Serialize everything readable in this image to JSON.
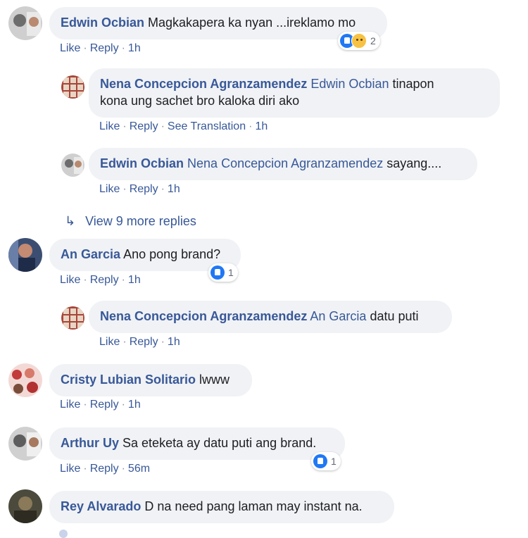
{
  "comments": [
    {
      "name": "Edwin Ocbian",
      "text": "Magkakapera ka nyan ...ireklamo mo",
      "actions": {
        "like": "Like",
        "reply": "Reply",
        "time": "1h"
      },
      "reactions": {
        "count": "2",
        "icons": [
          "like-icon",
          "sad-icon"
        ]
      },
      "replies": [
        {
          "name": "Nena Concepcion Agranzamendez",
          "tag": "Edwin Ocbian",
          "text_line1": "tinapon",
          "text_line2": "kona ung sachet bro kaloka diri ako",
          "actions": {
            "like": "Like",
            "reply": "Reply",
            "translate": "See Translation",
            "time": "1h"
          }
        },
        {
          "name": "Edwin Ocbian",
          "tag": "Nena Concepcion Agranzamendez",
          "text": "sayang....",
          "actions": {
            "like": "Like",
            "reply": "Reply",
            "time": "1h"
          }
        }
      ],
      "view_more": "View 9 more replies"
    },
    {
      "name": "An Garcia",
      "text": "Ano pong brand?",
      "actions": {
        "like": "Like",
        "reply": "Reply",
        "time": "1h"
      },
      "reactions": {
        "count": "1",
        "icons": [
          "like-icon"
        ]
      },
      "replies": [
        {
          "name": "Nena Concepcion Agranzamendez",
          "tag": "An Garcia",
          "text": "datu puti",
          "actions": {
            "like": "Like",
            "reply": "Reply",
            "time": "1h"
          }
        }
      ]
    },
    {
      "name": "Cristy Lubian Solitario",
      "text": "lwww",
      "actions": {
        "like": "Like",
        "reply": "Reply",
        "time": "1h"
      }
    },
    {
      "name": "Arthur Uy",
      "text": "Sa eteketa ay datu puti ang brand.",
      "actions": {
        "like": "Like",
        "reply": "Reply",
        "time": "56m"
      },
      "reactions": {
        "count": "1",
        "icons": [
          "like-icon"
        ]
      }
    },
    {
      "name": "Rey Alvarado",
      "text": "D na need pang laman may instant na."
    }
  ],
  "colors": {
    "link": "#385898",
    "bubble": "#f0f2f5",
    "like": "#2078f4"
  }
}
